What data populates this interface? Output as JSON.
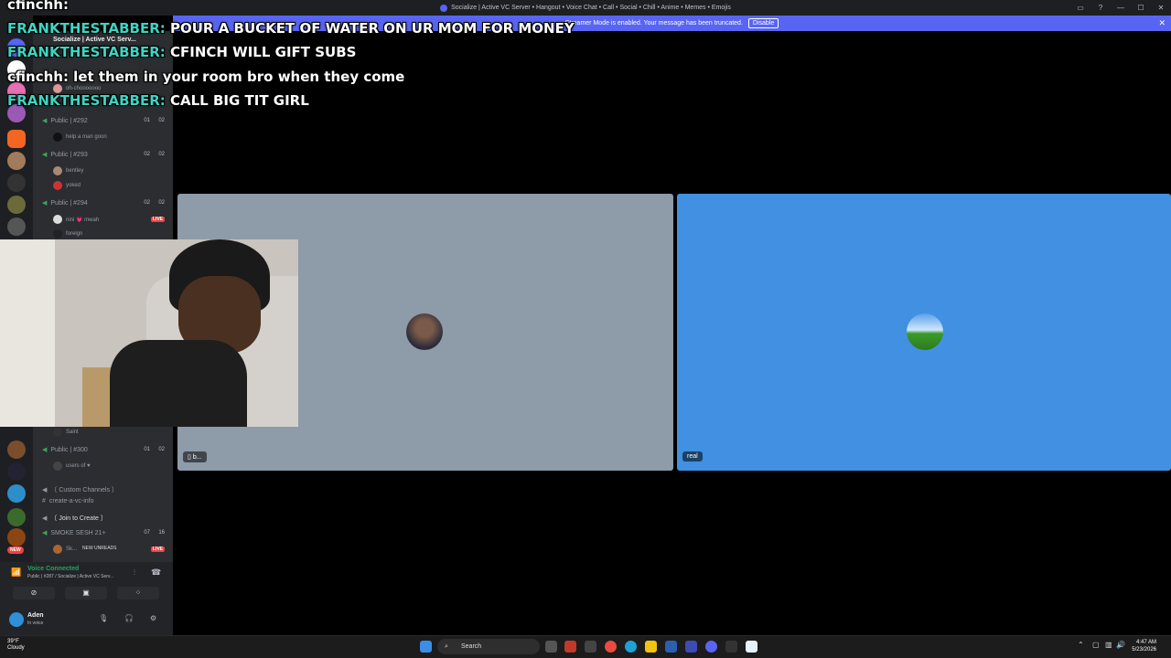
{
  "window": {
    "title": "Socialize | Active VC Server • Hangout • Voice Chat • Call • Social • Chill • Anime • Memes • Emojis"
  },
  "banner": {
    "text": "Streamer Mode is enabled. Your message has been truncated.",
    "button_label": "Disable"
  },
  "server": {
    "name": "Socialize | Active VC Serv..."
  },
  "channels": [
    {
      "name": "Public | #292",
      "count_a": "01",
      "count_b": "02",
      "users": [
        "help a man goon"
      ]
    },
    {
      "name": "Public | #293",
      "count_a": "02",
      "count_b": "02",
      "users": [
        "bentley",
        "yoked"
      ]
    },
    {
      "name": "Public | #294",
      "count_a": "02",
      "count_b": "02",
      "users": [
        "nini 💗 mwah",
        "foreign"
      ],
      "live": "LIVE"
    },
    {
      "name": "Public | #300",
      "count_a": "01",
      "count_b": "02",
      "users": [
        "users of ♥"
      ]
    }
  ],
  "top_user": "oh-chooooooo",
  "saint_user": "Saint",
  "category": "〔 Custom Channels 〕",
  "text_channel": "create-a-vc-info",
  "join_channel": "〔 Join to Create 〕",
  "smoke_channel": {
    "name": "SMOKE SESH 21+",
    "count_a": "07",
    "count_b": "16",
    "user": "Sk...",
    "live": "LIVE"
  },
  "unreads_label": "NEW UNREADS",
  "new_pill": "NEW",
  "voice": {
    "status": "Voice Connected",
    "location": "Public | #287 / Socialize | Active VC Serv..."
  },
  "me": {
    "name": "Aden",
    "status": "In voice"
  },
  "tiles": [
    {
      "label": "b...",
      "color": "#8e9ba8"
    },
    {
      "label": "real",
      "color": "#4190e2"
    }
  ],
  "chat_overlay": [
    {
      "user": "cfinchh:",
      "message": ""
    },
    {
      "user": "FRANKTHESTABBER:",
      "message": "POUR A BUCKET OF WATER ON UR MOM FOR MONEY"
    },
    {
      "user": "FRANKTHESTABBER:",
      "message": "CFINCH WILL GIFT SUBS"
    },
    {
      "user": "cfinchh:",
      "message": "let them in your room bro when they come"
    },
    {
      "user": "FRANKTHESTABBER:",
      "message": "CALL BIG TIT GIRL"
    }
  ],
  "taskbar": {
    "weather_temp": "39°F",
    "weather_desc": "Cloudy",
    "search_label": "Search",
    "time": "4:47 AM",
    "date": "5/23/2026"
  }
}
